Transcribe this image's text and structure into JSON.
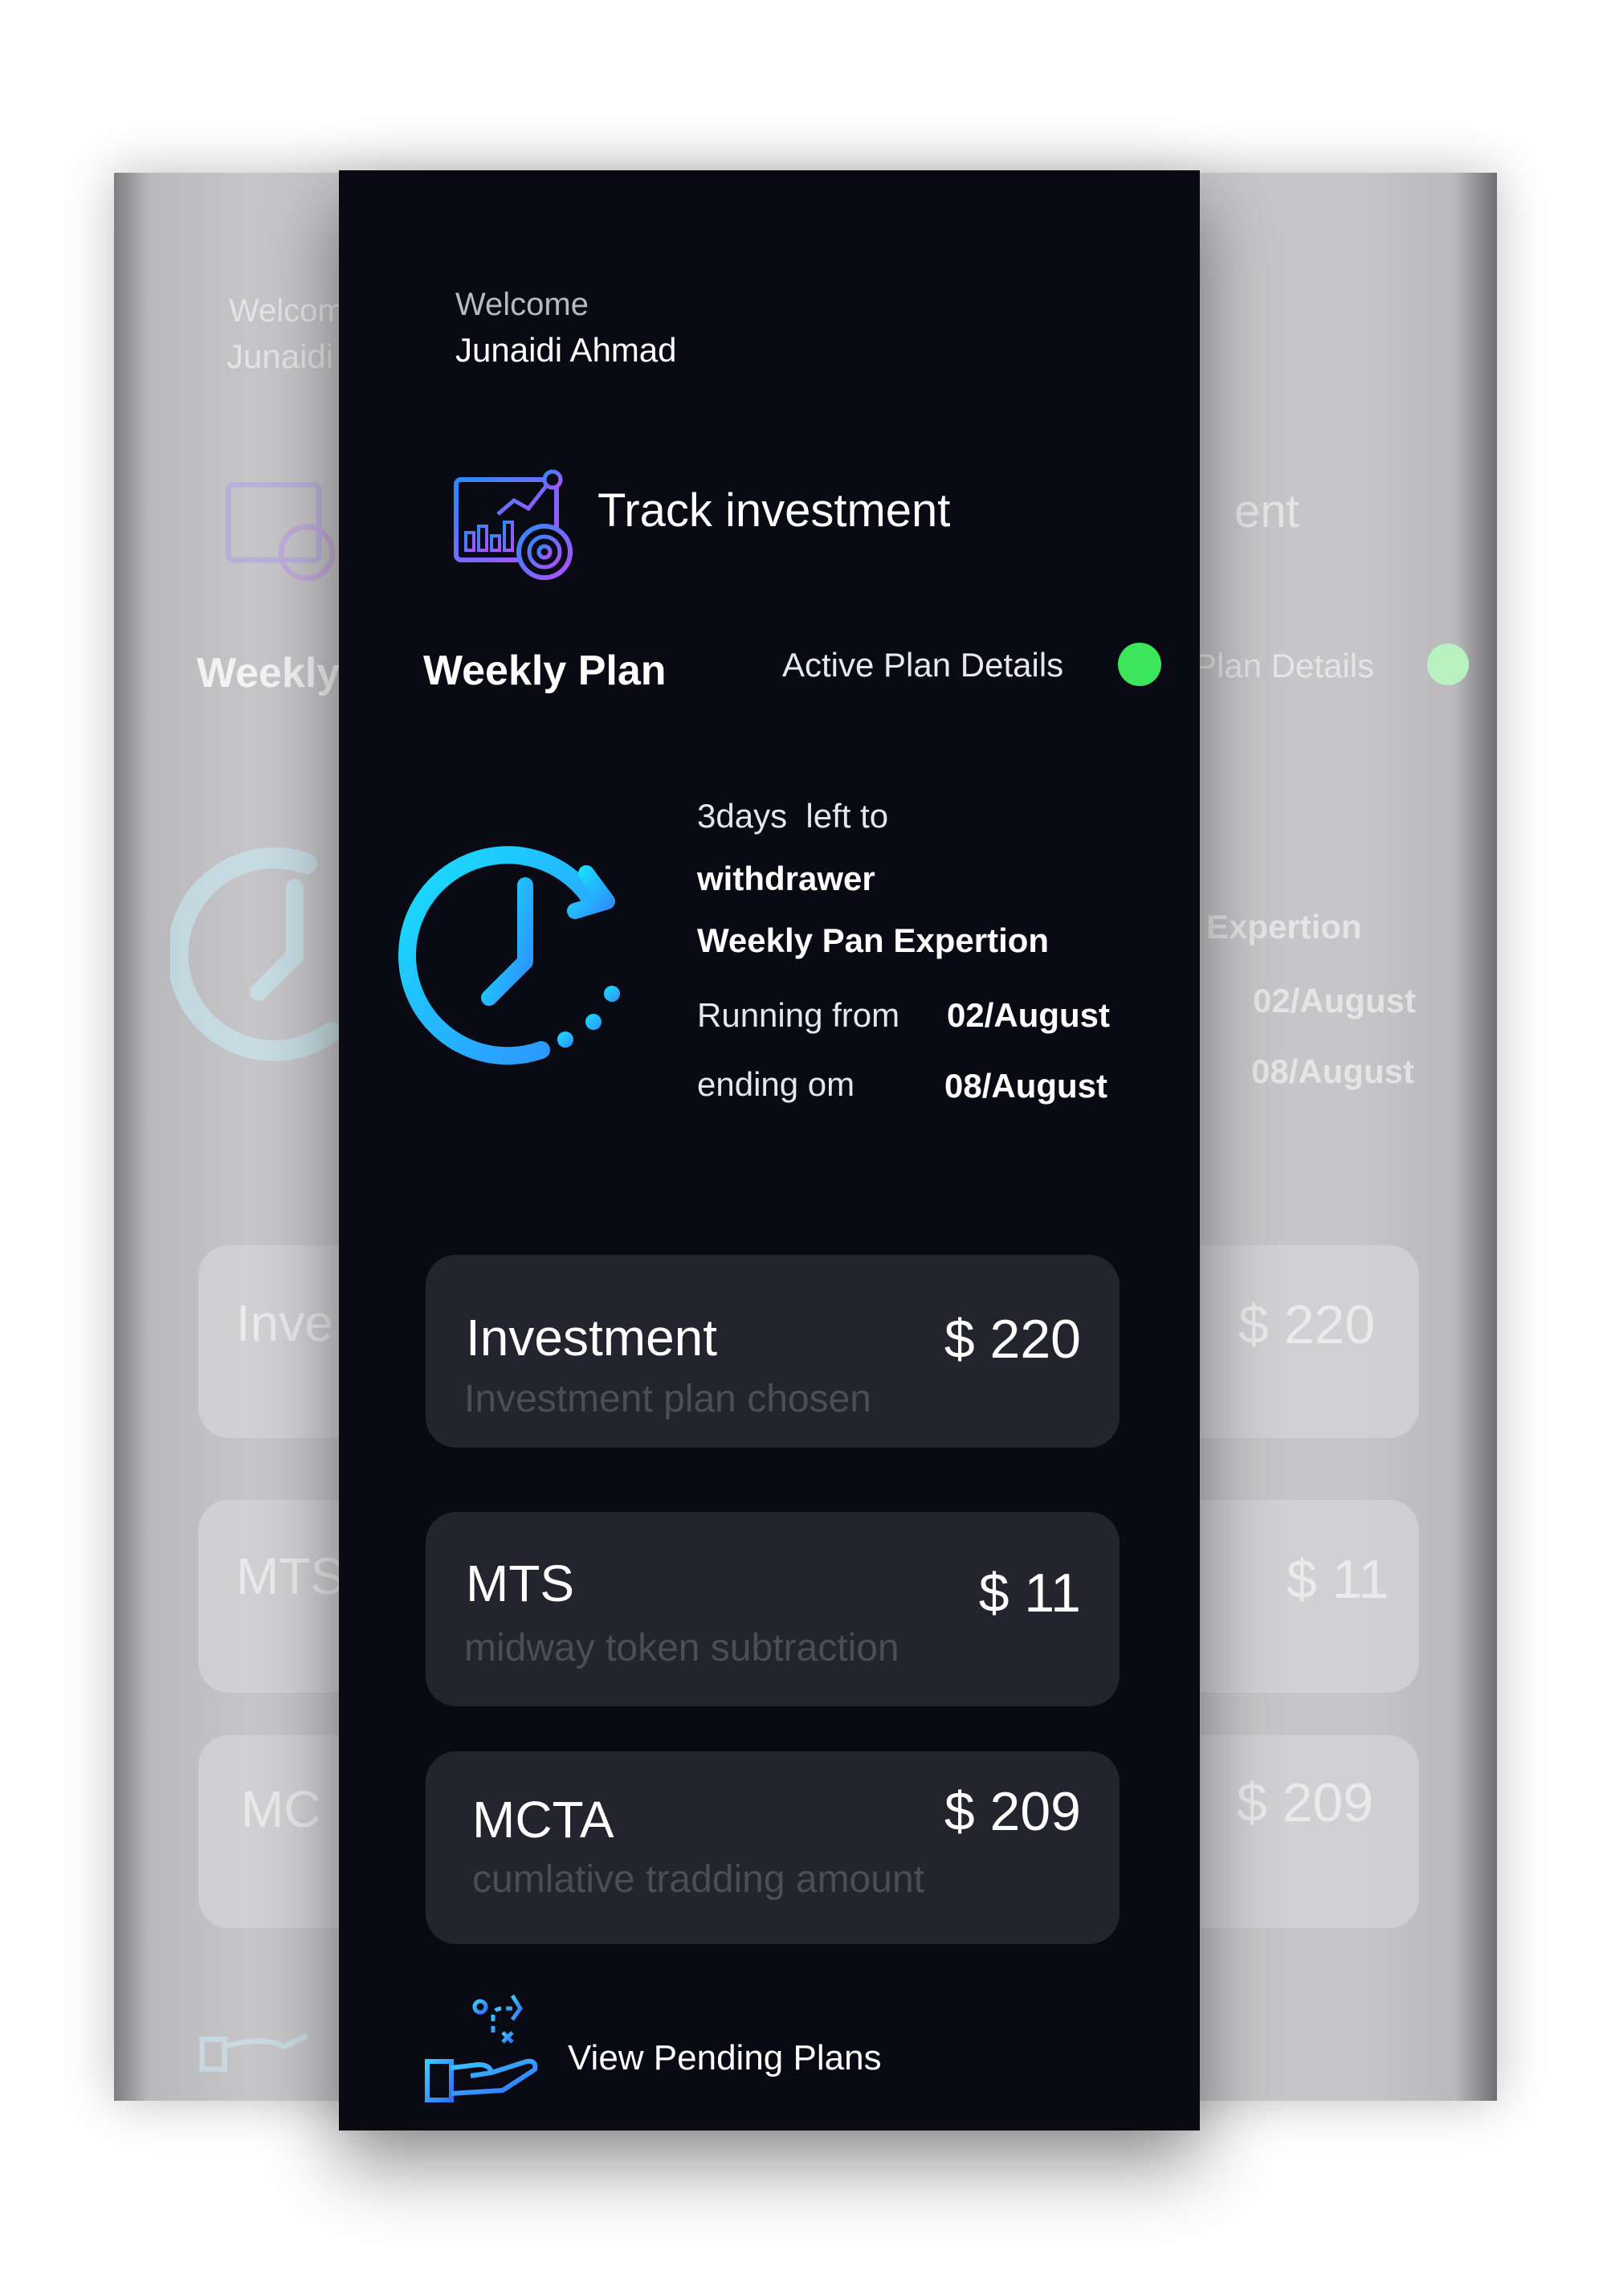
{
  "header": {
    "welcome_label": "Welcome",
    "user_name": "Junaidi Ahmad"
  },
  "track": {
    "title": "Track investment",
    "icon": "analytics-dashboard-icon"
  },
  "plan": {
    "title": "Weekly Plan",
    "active_label": "Active Plan Details",
    "status_color": "#3be65a"
  },
  "countdown": {
    "icon": "clock-refresh-icon",
    "days_left": "3days  left to",
    "action": "withdrawer",
    "expiry_label": "Weekly Pan Expertion",
    "running_label": "Running from",
    "running_date": "02/August",
    "ending_label": "ending om",
    "ending_date": "08/August"
  },
  "cards": [
    {
      "title": "Investment",
      "subtitle": "Investment plan chosen",
      "amount": "$ 220"
    },
    {
      "title": "MTS",
      "subtitle": "midway token subtraction",
      "amount": "$ 11"
    },
    {
      "title": "MCTA",
      "subtitle": "cumlative tradding amount",
      "amount": "$ 209"
    }
  ],
  "footer": {
    "pending_label": "View Pending Plans",
    "icon": "hand-strategy-icon"
  },
  "background_ghost": {
    "welcome_partial": "Welcom",
    "name_partial": "Junaidi",
    "plan_partial": "Weekly",
    "track_partial": "ent",
    "details_partial": "Plan Details",
    "expiry_partial": "Expertion",
    "running_date": "02/August",
    "ending_date": "08/August",
    "card_left_1": "Inve",
    "card_left_2": "MTS",
    "card_left_3": "MC",
    "amount_1": "$ 220",
    "amount_2": "$ 11",
    "amount_3": "$ 209"
  },
  "colors": {
    "panel_bg": "#0a0a14",
    "card_bg": "#24242e",
    "icon_gradient_start": "#2a8cff",
    "icon_gradient_end": "#b44dff",
    "clock_gradient_start": "#2fb8ff",
    "clock_gradient_end": "#18e0ff"
  }
}
